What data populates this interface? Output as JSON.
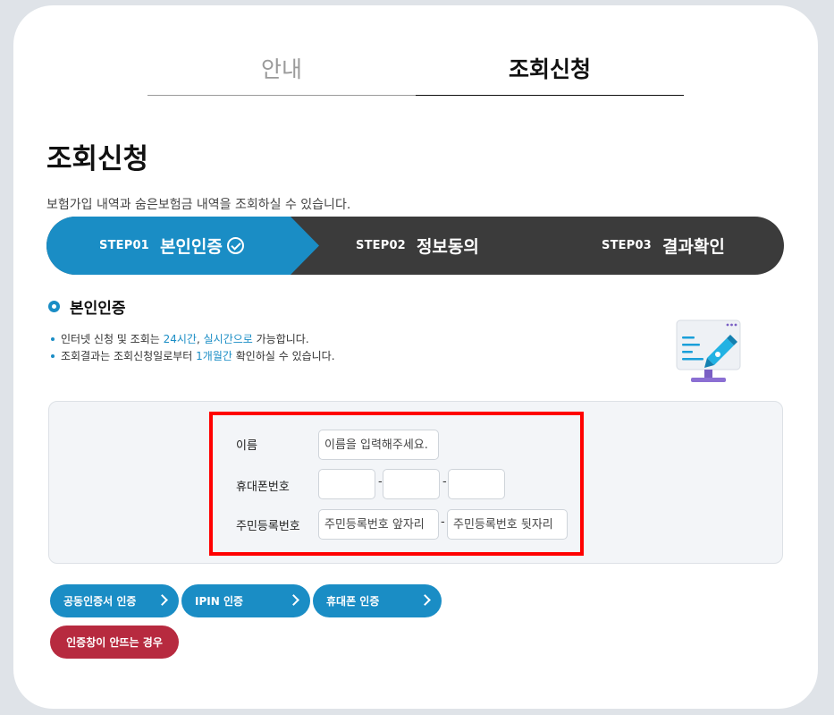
{
  "tabs": [
    {
      "label": "안내",
      "active": false
    },
    {
      "label": "조회신청",
      "active": true
    }
  ],
  "page": {
    "title": "조회신청",
    "subtitle": "보험가입 내역과 숨은보험금 내역을 조회하실 수 있습니다."
  },
  "steps": [
    {
      "num": "STEP01",
      "label": "본인인증",
      "active": true,
      "icon": "check-circle-icon"
    },
    {
      "num": "STEP02",
      "label": "정보동의",
      "active": false
    },
    {
      "num": "STEP03",
      "label": "결과확인",
      "active": false
    }
  ],
  "section": {
    "title": "본인인증",
    "notes": [
      {
        "pre": "인터넷 신청 및 조회는 ",
        "hl1": "24시간",
        "mid": ", ",
        "hl2": "실시간으로",
        "post": " 가능합니다."
      },
      {
        "pre": "조회결과는 조회신청일로부터 ",
        "hl1": "1개월간",
        "post": " 확인하실 수 있습니다."
      }
    ]
  },
  "form": {
    "name_label": "이름",
    "name_placeholder": "이름을 입력해주세요.",
    "phone_label": "휴대폰번호",
    "phone_sep": "-",
    "rrn_label": "주민등록번호",
    "rrn_front_placeholder": "주민등록번호 앞자리",
    "rrn_back_placeholder": "주민등록번호 뒷자리",
    "rrn_sep": "-"
  },
  "buttons": {
    "cert": "공동인증서 인증",
    "ipin": "IPIN 인증",
    "phone": "휴대폰 인증",
    "help": "인증창이 안뜨는 경우"
  },
  "colors": {
    "accent": "#1a8dc5",
    "stepbar_dark": "#3b3b3b",
    "help_red": "#b72a3f",
    "highlight_box": "#ff0000"
  }
}
